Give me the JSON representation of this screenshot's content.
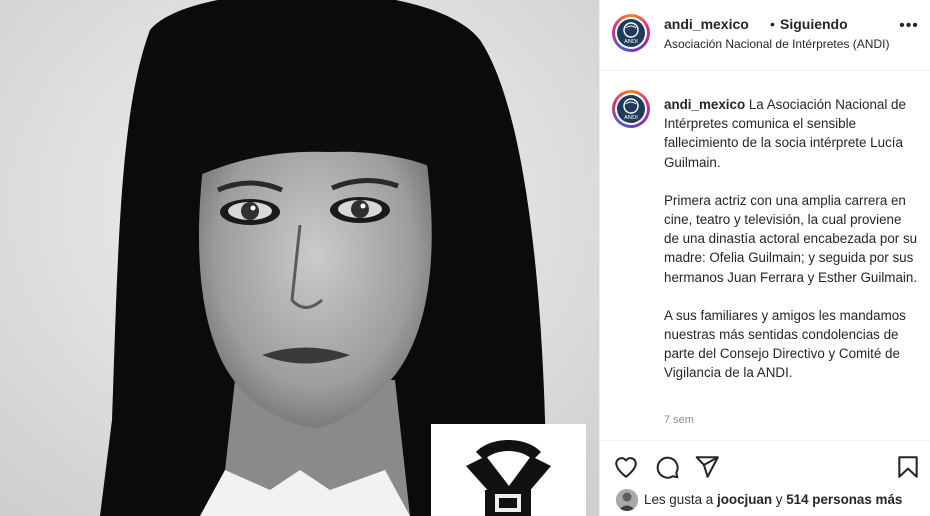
{
  "post": {
    "username": "andi_mexico",
    "separator": "•",
    "follow_status": "Siguiendo",
    "location": "Asociación Nacional de Intérpretes (ANDI)",
    "more_icon": "more-horizontal-icon"
  },
  "caption": {
    "username": "andi_mexico",
    "paragraph1": "La Asociación Nacional de Intérpretes comunica el sensible fallecimiento de la socia intérprete Lucía Guilmain.",
    "paragraph2": "Primera actriz con una amplia carrera en cine, teatro y televisión, la cual proviene de una dinastía actoral encabezada por su madre: Ofelia Guilmain; y seguida por sus hermanos Juan Ferrara y Esther Guilmain.",
    "paragraph3": "A sus familiares y amigos les mandamos nuestras más sentidas condolencias de parte del Consejo Directivo y Comité de Vigilancia de la ANDI.",
    "time": "7 sem"
  },
  "actions": {
    "like_icon": "heart-icon",
    "comment_icon": "comment-icon",
    "share_icon": "paper-plane-icon",
    "save_icon": "bookmark-icon"
  },
  "likes": {
    "prefix": "Les gusta a",
    "user": "joocjuan",
    "connector": "y",
    "others": "514 personas más"
  },
  "avatar_logo_text": "ANDI",
  "colors": {
    "accent_ring": "#dd2a7b",
    "text": "#262626",
    "muted": "#8e8e8e",
    "divider": "#efefef"
  }
}
